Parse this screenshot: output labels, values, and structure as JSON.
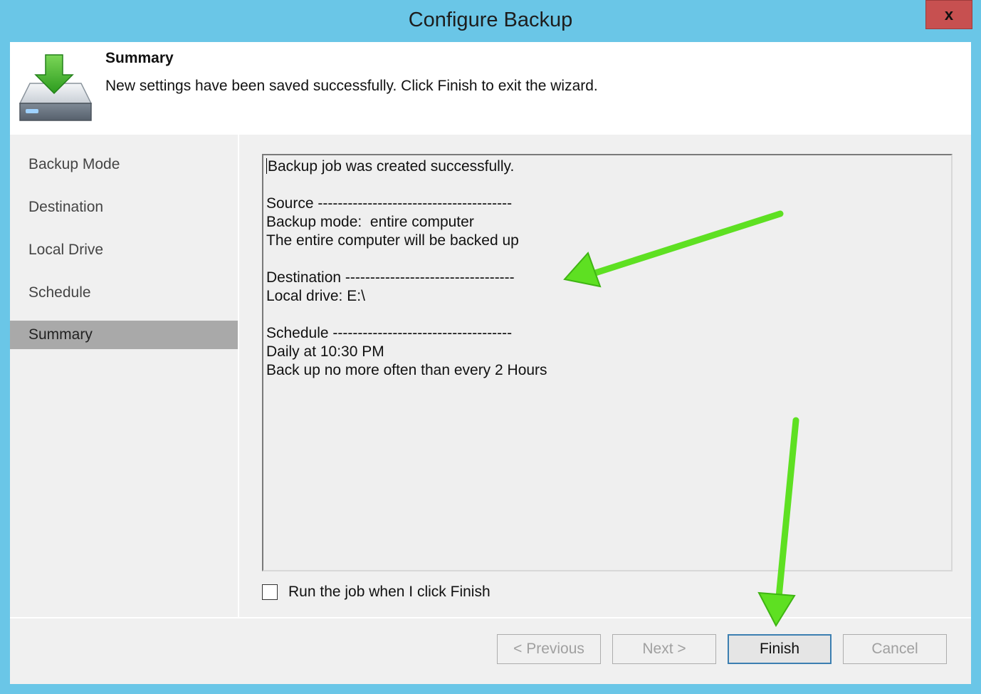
{
  "window": {
    "title": "Configure Backup",
    "close_label": "x"
  },
  "header": {
    "icon": "backup-drive-download-icon",
    "title": "Summary",
    "description": "New settings have been saved successfully. Click Finish to exit the wizard."
  },
  "sidebar": {
    "items": [
      {
        "label": "Backup Mode",
        "active": false
      },
      {
        "label": "Destination",
        "active": false
      },
      {
        "label": "Local Drive",
        "active": false
      },
      {
        "label": "Schedule",
        "active": false
      },
      {
        "label": "Summary",
        "active": true
      }
    ]
  },
  "summary": {
    "lines": [
      "Backup job was created successfully.",
      "",
      "Source ---------------------------------------",
      "Backup mode:  entire computer",
      "The entire computer will be backed up",
      "",
      "Destination ----------------------------------",
      "Local drive: E:\\",
      "",
      "Schedule ------------------------------------",
      "Daily at 10:30 PM",
      "Back up no more often than every 2 Hours"
    ]
  },
  "options": {
    "run_job_label": "Run the job when I click Finish",
    "run_job_checked": false
  },
  "buttons": {
    "previous": "< Previous",
    "next": "Next >",
    "finish": "Finish",
    "cancel": "Cancel"
  },
  "colors": {
    "titlebar": "#6ac6e7",
    "close": "#c75050",
    "annotation_arrow": "#5ee022",
    "active_nav": "#a9a9a9"
  }
}
